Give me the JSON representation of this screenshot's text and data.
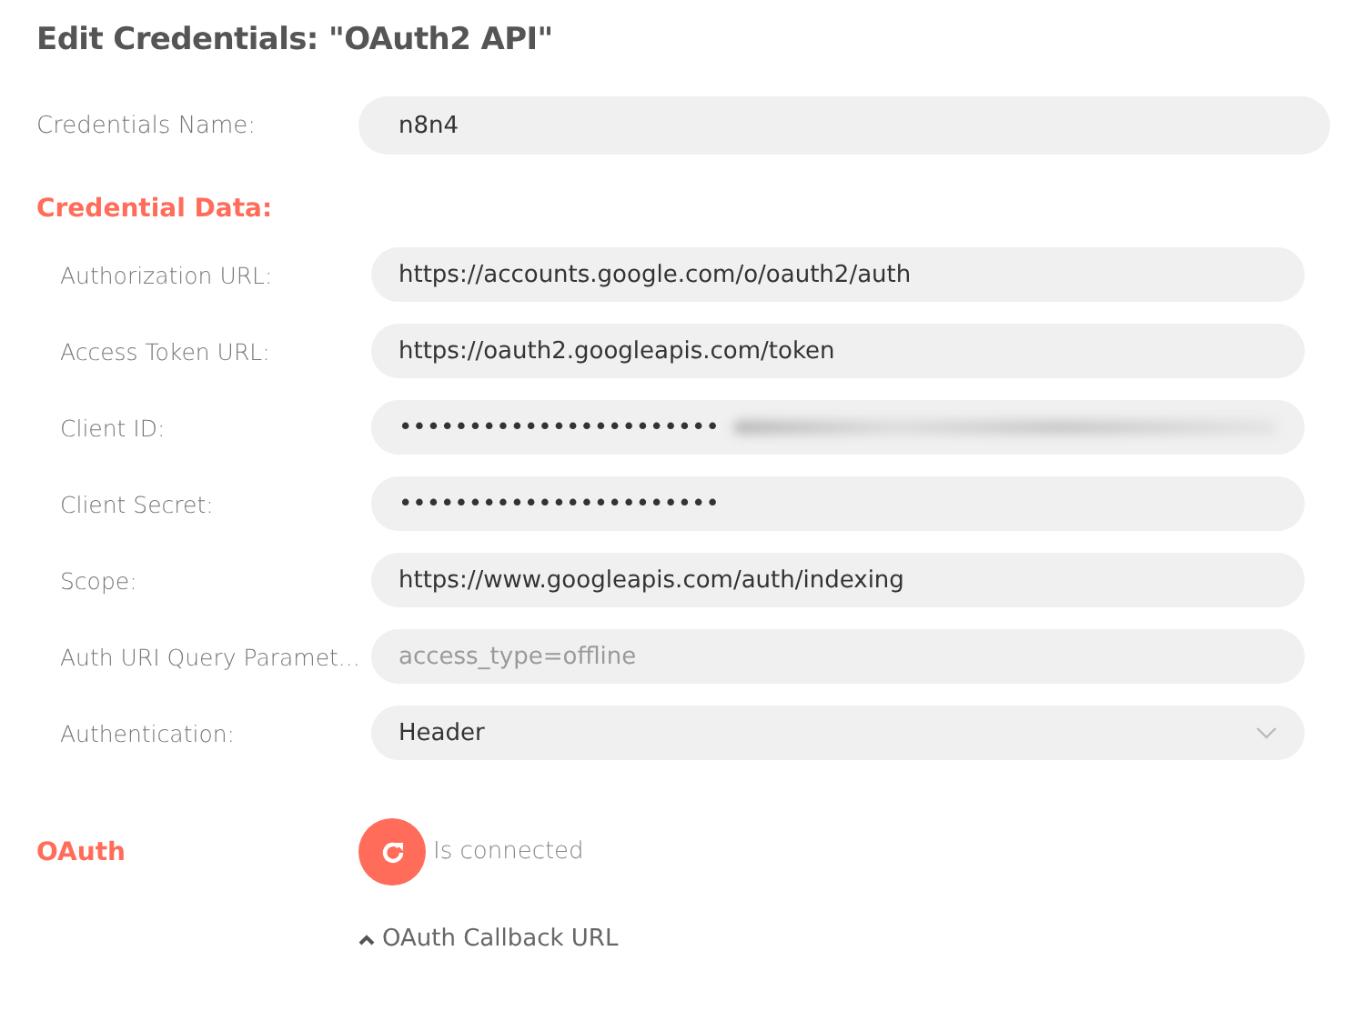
{
  "title": "Edit Credentials: \"OAuth2 API\"",
  "name_field": {
    "label": "Credentials Name:",
    "value": "n8n4"
  },
  "section_title": "Credential Data:",
  "fields": [
    {
      "label": "Authorization URL:",
      "kind": "text",
      "value": "https://accounts.google.com/o/oauth2/auth"
    },
    {
      "label": "Access Token URL:",
      "kind": "text",
      "value": "https://oauth2.googleapis.com/token"
    },
    {
      "label": "Client ID:",
      "kind": "redacted",
      "value": "•••••••••••••••••••••••"
    },
    {
      "label": "Client Secret:",
      "kind": "password",
      "value": "•••••••••••••••••••••••"
    },
    {
      "label": "Scope:",
      "kind": "text",
      "value": "https://www.googleapis.com/auth/indexing"
    },
    {
      "label": "Auth URI Query Paramet...",
      "kind": "text",
      "placeholder": "access_type=offline"
    },
    {
      "label": "Authentication:",
      "kind": "select",
      "value": "Header"
    }
  ],
  "oauth": {
    "label": "OAuth",
    "status": "Is connected",
    "callback_toggle": "OAuth Callback URL",
    "callback_expanded": false
  }
}
